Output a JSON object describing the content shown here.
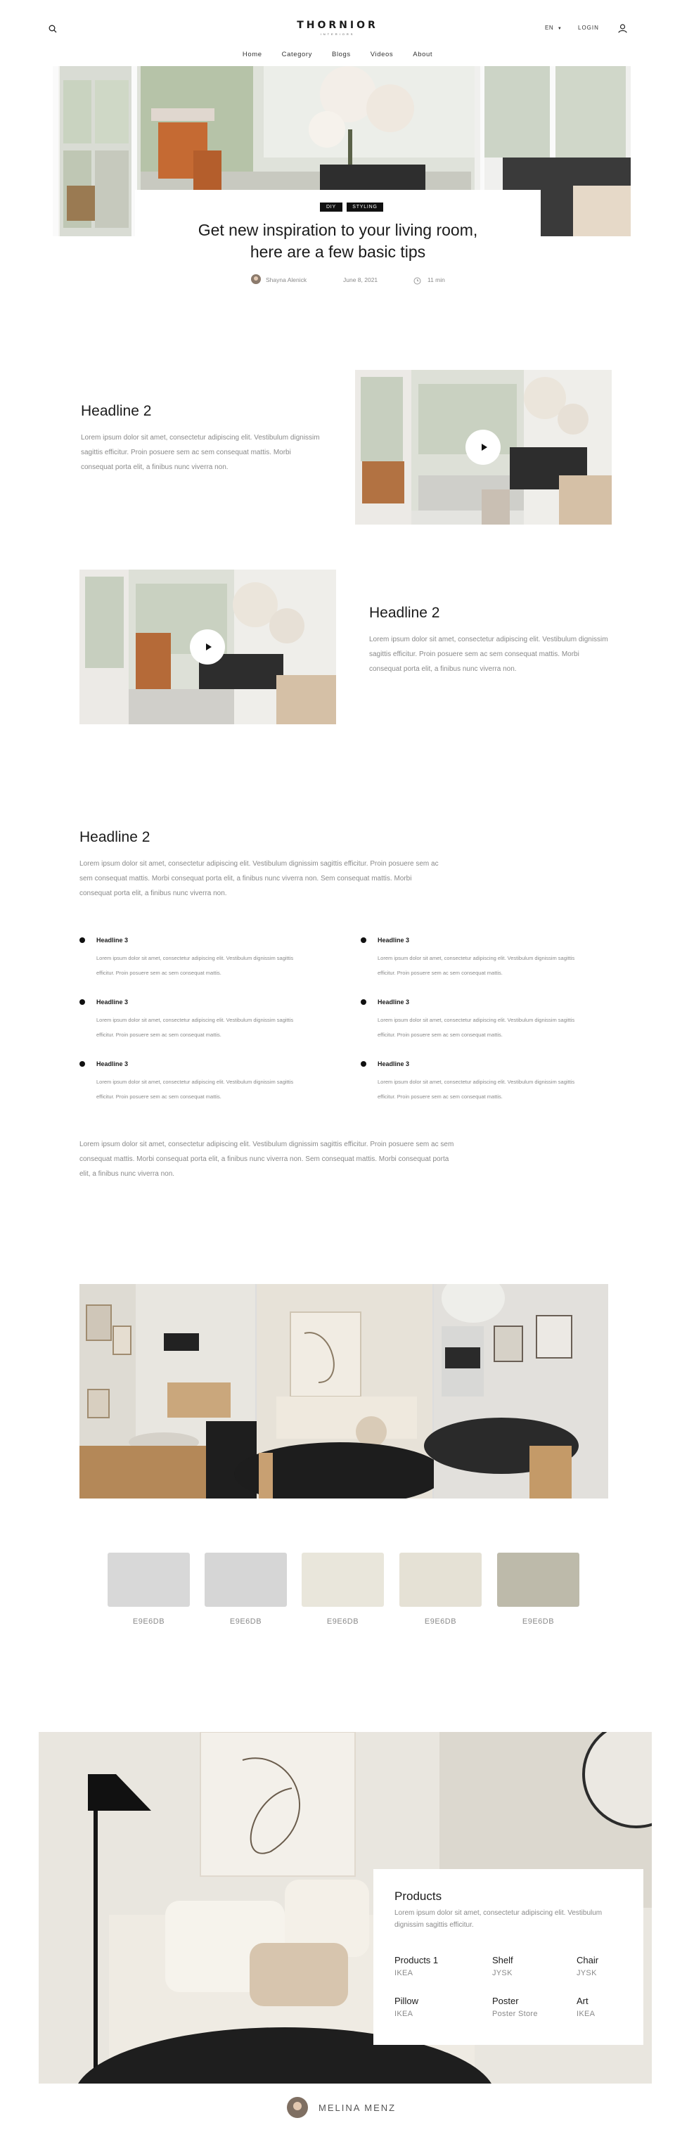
{
  "header": {
    "logo": "THORNIOR",
    "logo_sub": "INTERIORS",
    "lang": "EN",
    "login": "LOGIN",
    "nav": [
      "Home",
      "Category",
      "Blogs",
      "Videos",
      "About"
    ]
  },
  "hero": {
    "tags": [
      "DIY",
      "STYLING"
    ],
    "title_line1": "Get new inspiration to your living room,",
    "title_line2": "here are a few basic tips",
    "author": "Shayna Alenick",
    "date": "June 8, 2021",
    "read_time": "11 min"
  },
  "video_block_1": {
    "headline": "Headline 2",
    "text": "Lorem ipsum dolor sit amet, consectetur adipiscing elit. Vestibulum dignissim sagittis efficitur. Proin posuere sem ac sem consequat mattis. Morbi consequat porta elit, a finibus nunc viverra non."
  },
  "video_block_2": {
    "headline": "Headline 2",
    "text": "Lorem ipsum dolor sit amet, consectetur adipiscing elit. Vestibulum dignissim sagittis efficitur. Proin posuere sem ac sem consequat mattis. Morbi consequat porta elit, a finibus nunc viverra non."
  },
  "text_block": {
    "headline": "Headline 2",
    "intro": "Lorem ipsum dolor sit amet, consectetur adipiscing elit. Vestibulum dignissim sagittis efficitur. Proin posuere sem ac sem consequat mattis. Morbi consequat porta elit, a finibus nunc viverra non. Sem consequat mattis. Morbi consequat porta elit, a finibus nunc viverra non.",
    "bullets": [
      {
        "title": "Headline 3",
        "text": "Lorem ipsum dolor sit amet, consectetur adipiscing elit. Vestibulum dignissim sagittis efficitur. Proin posuere sem ac sem consequat mattis."
      },
      {
        "title": "Headline 3",
        "text": "Lorem ipsum dolor sit amet, consectetur adipiscing elit. Vestibulum dignissim sagittis efficitur. Proin posuere sem ac sem consequat mattis."
      },
      {
        "title": "Headline 3",
        "text": "Lorem ipsum dolor sit amet, consectetur adipiscing elit. Vestibulum dignissim sagittis efficitur. Proin posuere sem ac sem consequat mattis."
      },
      {
        "title": "Headline 3",
        "text": "Lorem ipsum dolor sit amet, consectetur adipiscing elit. Vestibulum dignissim sagittis efficitur. Proin posuere sem ac sem consequat mattis."
      },
      {
        "title": "Headline 3",
        "text": "Lorem ipsum dolor sit amet, consectetur adipiscing elit. Vestibulum dignissim sagittis efficitur. Proin posuere sem ac sem consequat mattis."
      },
      {
        "title": "Headline 3",
        "text": "Lorem ipsum dolor sit amet, consectetur adipiscing elit. Vestibulum dignissim sagittis efficitur. Proin posuere sem ac sem consequat mattis."
      }
    ],
    "outro": "Lorem ipsum dolor sit amet, consectetur adipiscing elit. Vestibulum dignissim sagittis efficitur. Proin posuere sem ac sem consequat mattis. Morbi consequat porta elit, a finibus nunc viverra non. Sem consequat mattis. Morbi consequat porta elit, a finibus nunc viverra non."
  },
  "palette": [
    {
      "label": "E9E6DB",
      "color": "#d8d8d8"
    },
    {
      "label": "E9E6DB",
      "color": "#d6d6d6"
    },
    {
      "label": "E9E6DB",
      "color": "#e9e6db"
    },
    {
      "label": "E9E6DB",
      "color": "#e5e1d5"
    },
    {
      "label": "E9E6DB",
      "color": "#bdbaaa"
    }
  ],
  "products": {
    "title": "Products",
    "text": "Lorem ipsum dolor sit amet, consectetur adipiscing elit. Vestibulum dignissim sagittis efficitur.",
    "items": [
      {
        "name": "Products 1",
        "brand": "IKEA"
      },
      {
        "name": "Shelf",
        "brand": "JYSK"
      },
      {
        "name": "Chair",
        "brand": "JYSK"
      },
      {
        "name": "Pillow",
        "brand": "IKEA"
      },
      {
        "name": "Poster",
        "brand": "Poster Store"
      },
      {
        "name": "Art",
        "brand": "IKEA"
      }
    ]
  },
  "footer_author": {
    "name": "MELINA MENZ"
  }
}
